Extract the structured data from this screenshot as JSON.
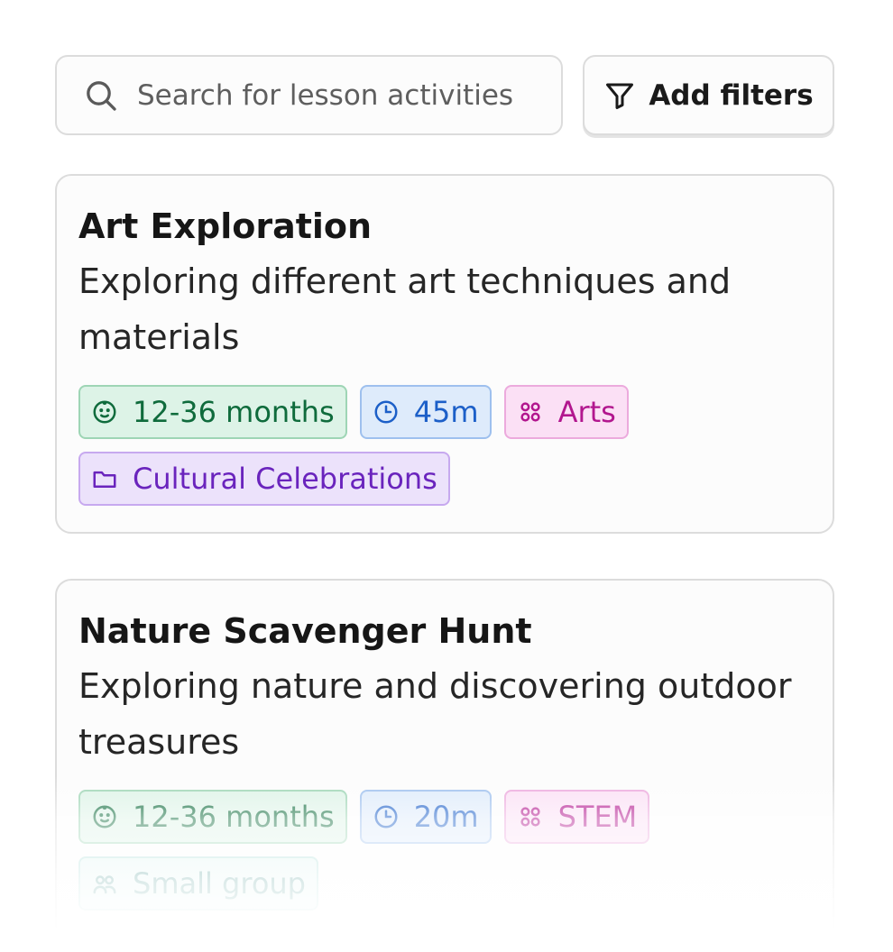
{
  "search": {
    "placeholder": "Search for lesson activities"
  },
  "filters_button": {
    "label": "Add filters"
  },
  "activities": [
    {
      "title": "Art Exploration",
      "description": "Exploring different art techniques and materials",
      "tags": [
        {
          "label": "12-36 months",
          "icon": "baby-face-icon",
          "color": "#0f6b3c"
        },
        {
          "label": "45m",
          "icon": "clock-icon",
          "color": "#1c5fc8"
        },
        {
          "label": "Arts",
          "icon": "category-grid-icon",
          "color": "#b2168e"
        },
        {
          "label": "Cultural Celebrations",
          "icon": "folder-icon",
          "color": "#6a24bd"
        }
      ]
    },
    {
      "title": "Nature Scavenger Hunt",
      "description": "Exploring nature and discovering outdoor treasures",
      "tags": [
        {
          "label": "12-36 months",
          "icon": "baby-face-icon",
          "color": "#0f6b3c"
        },
        {
          "label": "20m",
          "icon": "clock-icon",
          "color": "#1c5fc8"
        },
        {
          "label": "STEM",
          "icon": "category-grid-icon",
          "color": "#b2168e"
        },
        {
          "label": "Small group",
          "icon": "group-icon",
          "color": "#1a7a74"
        }
      ]
    }
  ]
}
